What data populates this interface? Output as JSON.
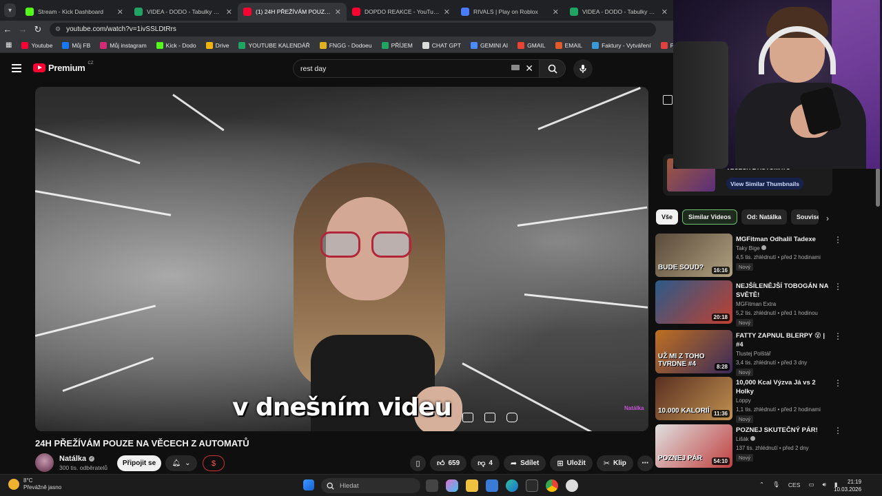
{
  "browser": {
    "tabs": [
      {
        "title": "Stream - Kick Dashboard",
        "color": "#53fc18",
        "active": false
      },
      {
        "title": "VIDEA - DODO - Tabulky Googl",
        "color": "#1fa463",
        "active": false
      },
      {
        "title": "(1) 24H PŘEŽÍVÁM POUZE NA V",
        "color": "#ff0033",
        "active": true
      },
      {
        "title": "DOPDO REAKCE - YouTube",
        "color": "#ff0033",
        "active": false
      },
      {
        "title": "RIVALS | Play on Roblox",
        "color": "#4a7cff",
        "active": false
      },
      {
        "title": "VIDEA - DODO - Tabulky Googl",
        "color": "#1fa463",
        "active": false
      }
    ],
    "url": "youtube.com/watch?v=1ivSSLDtRrs",
    "bookmarks": [
      {
        "label": "Youtube",
        "color": "#ff0033"
      },
      {
        "label": "Můj FB",
        "color": "#1877f2"
      },
      {
        "label": "Můj instagram",
        "color": "#d62976"
      },
      {
        "label": "Kick - Dodo",
        "color": "#53fc18"
      },
      {
        "label": "Drive",
        "color": "#f4b400"
      },
      {
        "label": "YOUTUBE KALENDÁŘ",
        "color": "#1fa463"
      },
      {
        "label": "FNGG - Dodoeu",
        "color": "#e0b020"
      },
      {
        "label": "PŘÍJEM",
        "color": "#1fa463"
      },
      {
        "label": "CHAT GPT",
        "color": "#dddddd"
      },
      {
        "label": "GEMINI AI",
        "color": "#4a8cff"
      },
      {
        "label": "GMAIL",
        "color": "#ea4335"
      },
      {
        "label": "EMAIL",
        "color": "#e05a2a"
      },
      {
        "label": "Faktury - Vytváření",
        "color": "#3a9ad9"
      },
      {
        "label": "PNG to PDF",
        "color": "#e04040"
      }
    ]
  },
  "youtube": {
    "brand": "Premium",
    "region": "CZ",
    "search_query": "rest day",
    "video": {
      "subtitle": "v dnešním videu",
      "watermark": "Natálka",
      "title": "24H PŘEŽÍVÁM POUZE NA VĚCECH Z AUTOMATŮ"
    },
    "channel": {
      "name": "Natálka",
      "subscribers": "300 tis. odběratelů",
      "join_label": "Připojit se",
      "thanks_icon": "$"
    },
    "actions": {
      "likes": "659",
      "dislikes": "4",
      "share": "Sdílet",
      "save": "Uložit",
      "clip": "Klip"
    },
    "side_card": {
      "label": "VĚCECH Z AUTOMATŮ",
      "button": "View Similar Thumbnails"
    },
    "chips": [
      "Vše",
      "Similar Videos",
      "Od: Natálka",
      "Souvise"
    ],
    "recommendations": [
      {
        "title": "MGFitman Odhalil Tadexe",
        "channel": "Taky Bige",
        "verified": true,
        "stats": "4,5 tis. zhlédnutí • před 2 hodinami",
        "badge": "Nový",
        "duration": "16:16",
        "thumb_text": "BUDE SOUD?",
        "c1": "#5a4a3a",
        "c2": "#b0a080"
      },
      {
        "title": "NEJŠÍLENĚJŠÍ TOBOGÁN NA SVĚTĚ!",
        "channel": "MGFitman Extra",
        "verified": false,
        "stats": "5,2 tis. zhlédnutí • před 1 hodinou",
        "badge": "Nový",
        "duration": "20:18",
        "thumb_text": "",
        "c1": "#2a5a8a",
        "c2": "#c04030"
      },
      {
        "title": "FATTY ZAPNUL BLERPY 😵 | #4",
        "channel": "Tlustej Polštář",
        "verified": false,
        "stats": "3,4 tis. zhlédnutí • před 3 dny",
        "badge": "Nový",
        "duration": "8:28",
        "thumb_text": "UŽ MI Z TOHO TVRDNE #4",
        "c1": "#c07020",
        "c2": "#3a2a5a"
      },
      {
        "title": "10,000 Kcal Výzva Já vs 2 Holky",
        "channel": "Loppy",
        "verified": false,
        "stats": "1,1 tis. zhlédnutí • před 2 hodinami",
        "badge": "Nový",
        "duration": "11:36",
        "thumb_text": "10.000 KALORIÍ",
        "c1": "#5a3020",
        "c2": "#c09050"
      },
      {
        "title": "POZNEJ SKUTEČNÝ PÁR!",
        "channel": "Lišák",
        "verified": true,
        "stats": "137 tis. zhlédnutí • před 2 dny",
        "badge": "Nový",
        "duration": "54:10",
        "thumb_text": "POZNEJ PÁR",
        "c1": "#e0e0e0",
        "c2": "#c04040"
      }
    ]
  },
  "taskbar": {
    "temperature": "8°C",
    "weather": "Převážně jasno",
    "search_placeholder": "Hledat",
    "language": "CES",
    "time": "21:19",
    "date": "10.03.2026"
  }
}
